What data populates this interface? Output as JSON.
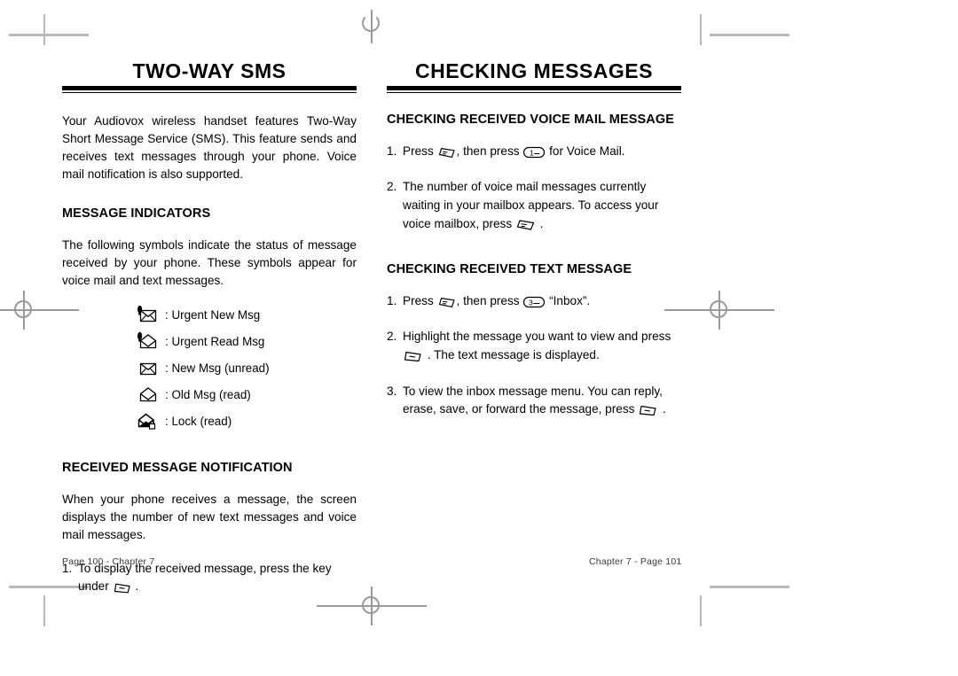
{
  "left_page": {
    "title": "TWO-WAY SMS",
    "intro": "Your Audiovox wireless handset features Two-Way Short Message Service (SMS). This feature sends and receives text messages through your phone. Voice mail notification is also supported.",
    "indicators_heading": "MESSAGE INDICATORS",
    "indicators_intro": "The following symbols indicate the status of message received by your phone. These symbols appear for voice mail and text messages.",
    "indicators": [
      {
        "icon": "urgent-new-message-envelope-icon",
        "label": ": Urgent New Msg"
      },
      {
        "icon": "urgent-read-message-envelope-icon",
        "label": ": Urgent Read Msg"
      },
      {
        "icon": "new-message-envelope-icon",
        "label": ": New Msg (unread)"
      },
      {
        "icon": "old-message-envelope-icon",
        "label": ": Old Msg (read)"
      },
      {
        "icon": "locked-message-envelope-icon",
        "label": ": Lock (read)"
      }
    ],
    "notification_heading": "RECEIVED MESSAGE NOTIFICATION",
    "notification_body": "When your phone receives a message, the screen displays the number of new text messages and voice mail messages.",
    "notification_steps": [
      {
        "num": "1.",
        "before": "To display the received message, press the key under",
        "icon": "soft-key-icon",
        "after": "."
      }
    ],
    "footer": "Page 100 - Chapter 7"
  },
  "right_page": {
    "title": "CHECKING MESSAGES",
    "voicemail_heading": "CHECKING RECEIVED VOICE MAIL MESSAGE",
    "voicemail_steps": [
      {
        "num": "1.",
        "before": "Press",
        "icon": "send-key-icon",
        "middle": ", then press",
        "icon2": "key-1-icon",
        "after": "for Voice Mail."
      },
      {
        "num": "2.",
        "before": "The number of voice mail messages currently waiting in your mailbox appears. To access your voice mailbox, press",
        "icon": "send-key-icon",
        "after": "."
      }
    ],
    "text_heading": "CHECKING RECEIVED TEXT MESSAGE",
    "text_steps": [
      {
        "num": "1.",
        "before": "Press",
        "icon": "send-key-icon",
        "middle": ", then press",
        "icon2": "key-3-icon",
        "after": "“Inbox”."
      },
      {
        "num": "2.",
        "before": "Highlight the message you want to view and press",
        "icon": "soft-key-icon",
        "after": ". The text message is displayed."
      },
      {
        "num": "3.",
        "before": "To view the inbox message menu. You can reply, erase, save, or forward the message, press",
        "icon": "soft-key-icon",
        "after": "."
      }
    ],
    "footer": "Chapter 7 - Page 101"
  },
  "keys": {
    "key_1_label": "1",
    "key_3_label": "3"
  },
  "colors": {
    "ink": "#000000",
    "crop_mark": "#b9b9b9",
    "registration": "#9a9a9a",
    "footer_text": "#3a3a3a"
  }
}
